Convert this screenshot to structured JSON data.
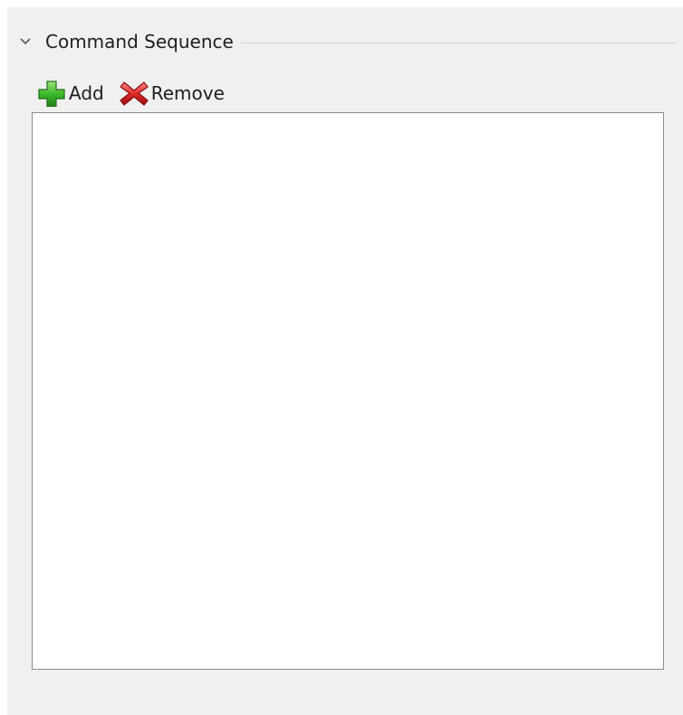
{
  "section": {
    "title": "Command Sequence",
    "expanded": true
  },
  "toolbar": {
    "add_label": "Add",
    "add_icon": "add-icon",
    "remove_label": "Remove",
    "remove_icon": "remove-icon"
  },
  "command_list": {
    "items": []
  },
  "colors": {
    "panel_bg": "#f0f0f0",
    "list_bg": "#ffffff",
    "list_border": "#8a8a96",
    "add_green": "#3cb72a",
    "remove_red": "#d8202a",
    "text": "#1e1e1e"
  }
}
